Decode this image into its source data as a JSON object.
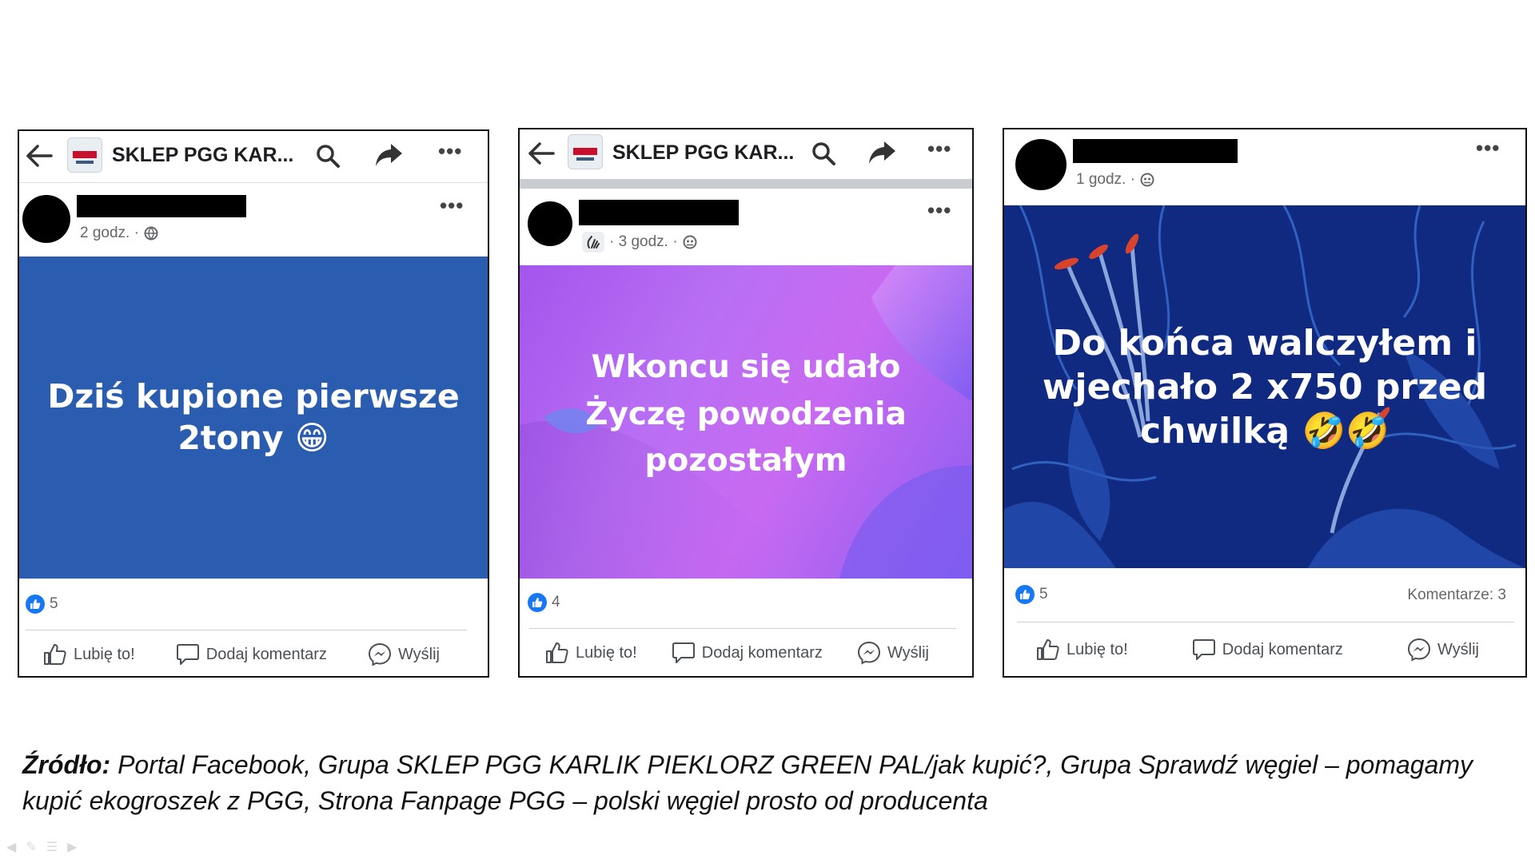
{
  "posts": [
    {
      "group_name": "SKLEP PGG KAR...",
      "time": "2 godz. ·",
      "image_text_line1": "Dziś kupione pierwsze",
      "image_text_line2": "2tony 😁",
      "image_bg": "#2a5cb0",
      "reaction_count": "5",
      "comments": "",
      "like_label": "Lubię to!",
      "comment_label": "Dodaj komentarz",
      "send_label": "Wyślij"
    },
    {
      "group_name": "SKLEP PGG KAR...",
      "time": "· 3 godz. ·",
      "image_text_line1": "Wkoncu się udało",
      "image_text_line2": "Życzę  powodzenia",
      "image_text_line3": "pozostałym",
      "reaction_count": "4",
      "like_label": "Lubię to!",
      "comment_label": "Dodaj komentarz",
      "send_label": "Wyślij"
    },
    {
      "time": "1 godz. ·",
      "image_text_line1": "Do końca walczyłem i",
      "image_text_line2": "wjechało 2 x750 przed",
      "image_text_line3": "chwilką 🤣🤣",
      "image_bg": "#0f2a80",
      "reaction_count": "5",
      "comments": "Komentarze: 3",
      "like_label": "Lubię to!",
      "comment_label": "Dodaj komentarz",
      "send_label": "Wyślij"
    }
  ],
  "caption": {
    "label": "Źródło:",
    "text": " Portal Facebook, Grupa SKLEP PGG KARLIK PIEKLORZ GREEN PAL/jak kupić?, Grupa Sprawdź węgiel – pomagamy kupić ekogroszek z PGG, Strona Fanpage PGG – polski węgiel prosto od producenta"
  },
  "colors": {
    "fb_blue": "#1877f2",
    "border": "#111111",
    "muted_text": "#65676b"
  }
}
